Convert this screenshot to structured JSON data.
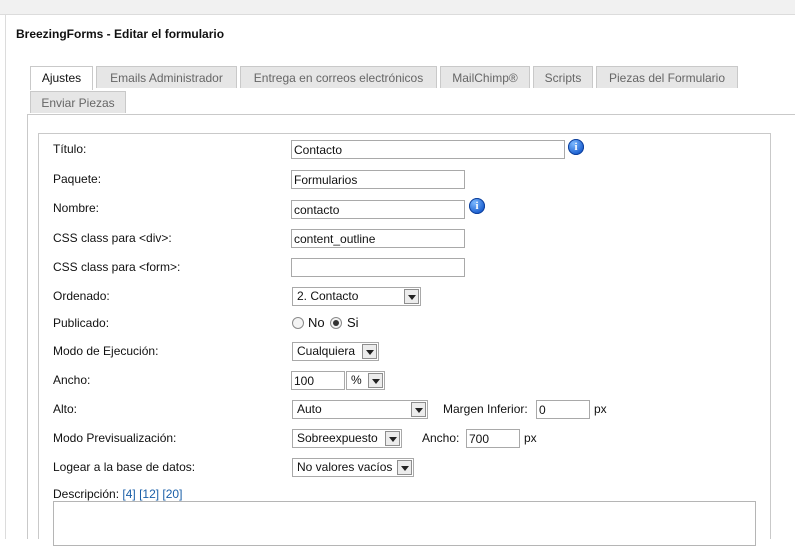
{
  "page": {
    "title": "BreezingForms - Editar el formulario"
  },
  "tabs": [
    {
      "label": "Ajustes",
      "active": true
    },
    {
      "label": "Emails Administrador",
      "active": false
    },
    {
      "label": "Entrega en correos electrónicos",
      "active": false
    },
    {
      "label": "MailChimp®",
      "active": false
    },
    {
      "label": "Scripts",
      "active": false
    },
    {
      "label": "Piezas del Formulario",
      "active": false
    },
    {
      "label": "Enviar Piezas",
      "active": false
    }
  ],
  "form": {
    "titulo": {
      "label": "Título:",
      "value": "Contacto"
    },
    "paquete": {
      "label": "Paquete:",
      "value": "Formularios"
    },
    "nombre": {
      "label": "Nombre:",
      "value": "contacto"
    },
    "css_div": {
      "label": "CSS class para <div>:",
      "value": "content_outline"
    },
    "css_form": {
      "label": "CSS class para <form>:",
      "value": ""
    },
    "ordenado": {
      "label": "Ordenado:",
      "value": "2. Contacto"
    },
    "publicado": {
      "label": "Publicado:",
      "option_no": "No",
      "option_si": "Si",
      "selected": "Si"
    },
    "modo_ejecucion": {
      "label": "Modo de Ejecución:",
      "value": "Cualquiera"
    },
    "ancho": {
      "label": "Ancho:",
      "value": "100",
      "unit": "%"
    },
    "alto": {
      "label": "Alto:",
      "value": "Auto",
      "margen_label": "Margen Inferior:",
      "margen_value": "0",
      "margen_unit": "px"
    },
    "previsualizacion": {
      "label": "Modo Previsualización:",
      "value": "Sobreexpuesto",
      "ancho_label": "Ancho:",
      "ancho_value": "700",
      "ancho_unit": "px"
    },
    "logear": {
      "label": "Logear a la base de datos:",
      "value": "No valores vacíos"
    },
    "descripcion": {
      "label": "Descripción:",
      "links": [
        "[4]",
        "[12]",
        "[20]"
      ]
    }
  },
  "icons": {
    "info": "info-icon",
    "info_glyph": "i"
  },
  "colors": {
    "link": "#1a5fa8",
    "info": "#1b5fcf",
    "tab_inactive_bg": "#e6e6e6"
  }
}
